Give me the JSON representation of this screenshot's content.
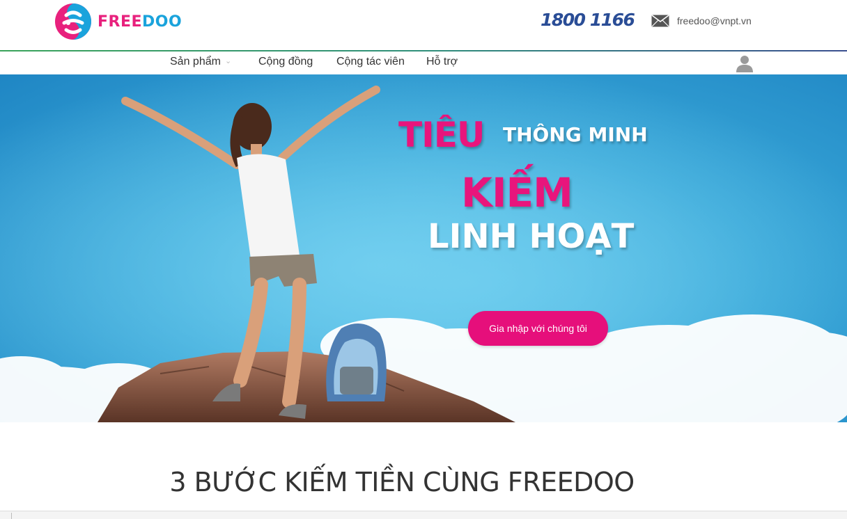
{
  "header": {
    "logo": {
      "free": "FREE",
      "doo": "DOO"
    },
    "hotline": "1800 1166",
    "email": "freedoo@vnpt.vn",
    "icons": {
      "mail": "envelope-icon",
      "user": "user-icon"
    }
  },
  "nav": {
    "items": [
      {
        "label": "Sản phẩm",
        "has_dropdown": true
      },
      {
        "label": "Cộng đồng",
        "has_dropdown": false
      },
      {
        "label": "Cộng tác viên",
        "has_dropdown": false
      },
      {
        "label": "Hỗ trợ",
        "has_dropdown": false
      }
    ]
  },
  "hero": {
    "line1a": "TIÊU",
    "line1b": "THÔNG MINH",
    "line2": "KIẾM",
    "line3": "LINH HOẠT",
    "cta_label": "Gia nhập với chúng tôi"
  },
  "section": {
    "title": "3 BƯỚC KIẾM TIỀN CÙNG FREEDOO"
  },
  "colors": {
    "brand_pink": "#e8217d",
    "brand_blue": "#1aa3dc",
    "hotline_blue": "#2a4d96",
    "cta_pink": "#e60f7b",
    "sky": "#39a7d8"
  }
}
